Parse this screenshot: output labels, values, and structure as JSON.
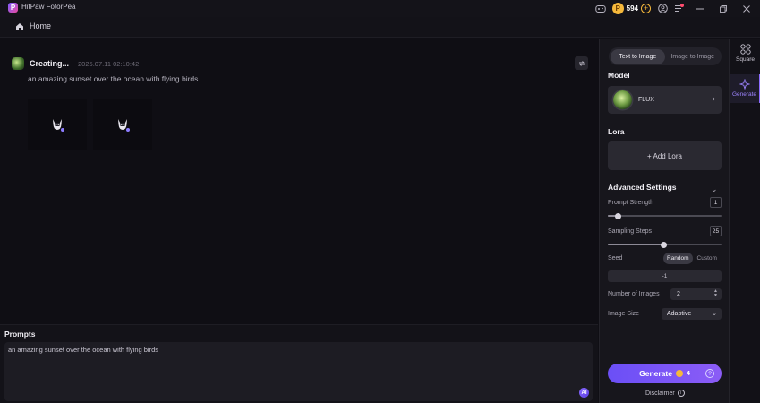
{
  "window": {
    "title": "HitPaw FotorPea",
    "logo_letter": "P",
    "coins": "594"
  },
  "nav": {
    "home_label": "Home"
  },
  "main": {
    "status": "Creating...",
    "timestamp": "2025.07.11  02:10:42",
    "prompt": "an amazing sunset over the ocean with flying birds",
    "slots": 2
  },
  "prompts_panel": {
    "title": "Prompts",
    "text": "an amazing sunset over the ocean with flying birds",
    "ai_badge": "AI"
  },
  "settings": {
    "mode_tabs": [
      "Text to Image",
      "Image to Image"
    ],
    "active_mode": "Text to Image",
    "model_title": "Model",
    "model_name": "FLUX",
    "lora_title": "Lora",
    "add_lora": "+ Add Lora",
    "advanced_title": "Advanced Settings",
    "prompt_strength_label": "Prompt Strength",
    "prompt_strength_value": "1",
    "prompt_strength_fraction": 0.09,
    "sampling_steps_label": "Sampling Steps",
    "sampling_steps_value": "25",
    "sampling_steps_fraction": 0.49,
    "seed_label": "Seed",
    "seed_options": [
      "Random",
      "Custom"
    ],
    "seed_active": "Random",
    "seed_value": "-1",
    "num_images_label": "Number of Images",
    "num_images_value": "2",
    "image_size_label": "Image Size",
    "image_size_value": "Adaptive",
    "generate_label": "Generate",
    "generate_cost": "4",
    "disclaimer": "Disclaimer"
  },
  "rail": {
    "items": [
      {
        "label": "Square",
        "icon": "grid-icon"
      },
      {
        "label": "Generate",
        "icon": "sparkle-icon"
      }
    ]
  },
  "colors": {
    "accent": "#7b5cf6",
    "coin": "#f5b83b",
    "background": "#0f0e14"
  }
}
